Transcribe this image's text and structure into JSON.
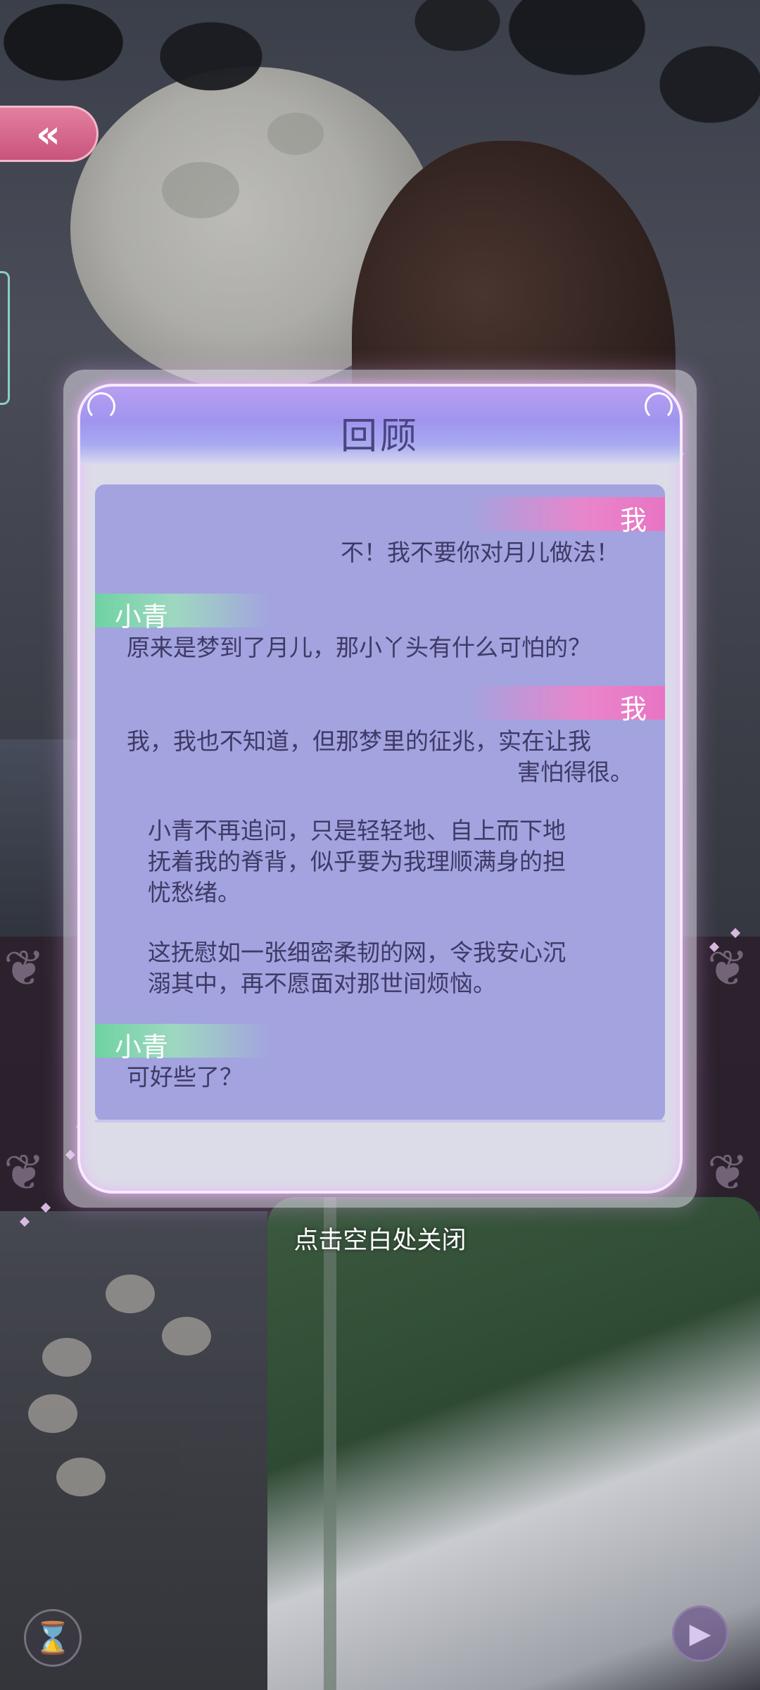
{
  "top_bar": {
    "back_label": "«"
  },
  "dialog": {
    "title": "回顾",
    "entries": [
      {
        "speaker": "我",
        "text": "不！我不要你对月儿做法！"
      },
      {
        "speaker": "小青",
        "text": "原来是梦到了月儿，那小丫头有什么可怕的？"
      },
      {
        "speaker": "我",
        "text_line1": "我，我也不知道，但那梦里的征兆，实在让我",
        "text_line2": "害怕得很。"
      },
      {
        "narration_lines": [
          "小青不再追问，只是轻轻地、自上而下地",
          "抚着我的脊背，似乎要为我理顺满身的担",
          "忧愁绪。"
        ]
      },
      {
        "narration_lines": [
          "这抚慰如一张细密柔韧的网，令我安心沉",
          "溺其中，再不愿面对那世间烦恼。"
        ]
      },
      {
        "speaker": "小青",
        "text": "可好些了？"
      }
    ]
  },
  "close_hint": "点击空白处关闭",
  "controls": {
    "hourglass_icon": "⌛",
    "play_icon": "▶"
  },
  "colors": {
    "me_tag": "#e874c3",
    "other_tag": "#6fd2a3",
    "panel": "#a3a3df",
    "text": "#3d3a66"
  }
}
